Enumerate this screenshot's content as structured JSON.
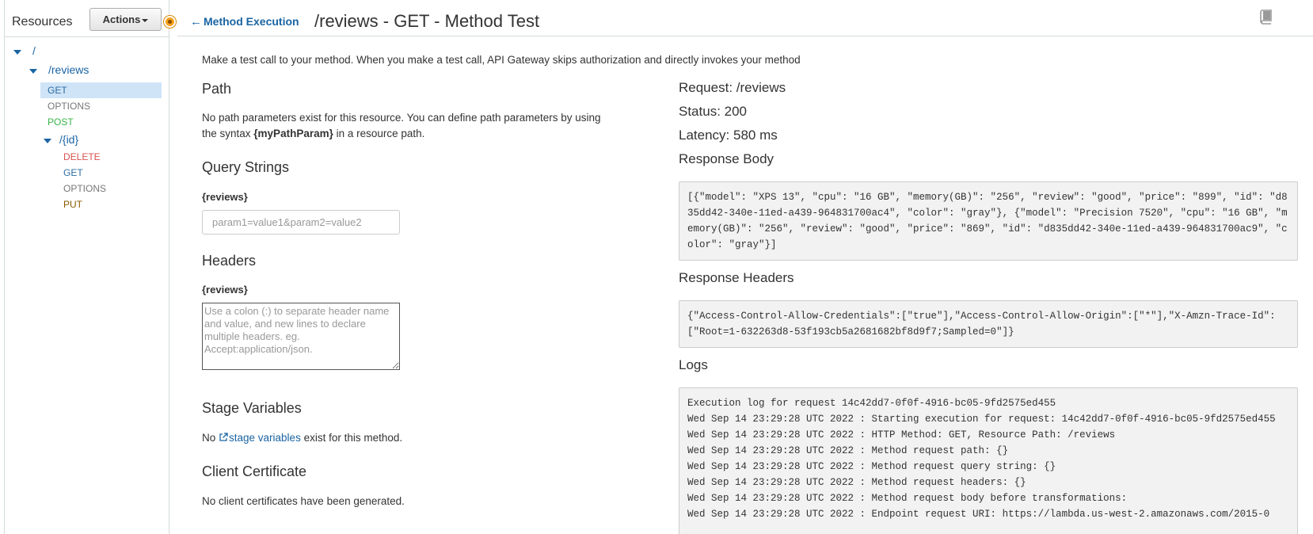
{
  "sidebar": {
    "title": "Resources",
    "actions_label": "Actions",
    "tree": {
      "root": "/",
      "reviews": "/reviews",
      "reviews_methods": [
        "GET",
        "OPTIONS",
        "POST"
      ],
      "id": "/{id}",
      "id_methods": [
        "DELETE",
        "GET",
        "OPTIONS",
        "PUT"
      ]
    },
    "method_colors": {
      "GET": "#2e6da4",
      "OPTIONS": "#777777",
      "POST": "#39b54a",
      "DELETE": "#d9534f",
      "PUT": "#8a5a00"
    }
  },
  "header": {
    "back_label": "Method Execution",
    "title": "/reviews - GET - Method Test",
    "doc_icon": "book-icon"
  },
  "form": {
    "intro": "Make a test call to your method. When you make a test call, API Gateway skips authorization and directly invokes your method",
    "path_heading": "Path",
    "path_text_1": "No path parameters exist for this resource. You can define path parameters by using",
    "path_text_2a": "the syntax ",
    "path_text_2b": "{myPathParam}",
    "path_text_2c": " in a resource path.",
    "query_heading": "Query Strings",
    "query_label": "{reviews}",
    "query_placeholder": "param1=value1&param2=value2",
    "headers_heading": "Headers",
    "headers_label": "{reviews}",
    "headers_placeholder": "Use a colon (:) to separate header name and value, and new lines to declare multiple headers. eg. Accept:application/json.",
    "stage_heading": "Stage Variables",
    "stage_text_a": "No ",
    "stage_link": "stage variables",
    "stage_text_b": " exist for this method.",
    "cert_heading": "Client Certificate",
    "cert_text": "No client certificates have been generated."
  },
  "result": {
    "request": "Request: /reviews",
    "status": "Status: 200",
    "latency": "Latency: 580 ms",
    "body_heading": "Response Body",
    "body": "[{\"model\": \"XPS 13\", \"cpu\": \"16 GB\", \"memory(GB)\": \"256\", \"review\": \"good\", \"price\": \"899\", \"id\": \"d835dd42-340e-11ed-a439-964831700ac4\", \"color\": \"gray\"}, {\"model\": \"Precision 7520\", \"cpu\": \"16 GB\", \"memory(GB)\": \"256\", \"review\": \"good\", \"price\": \"869\", \"id\": \"d835dd42-340e-11ed-a439-964831700ac9\", \"color\": \"gray\"}]",
    "headers_heading": "Response Headers",
    "headers": "{\"Access-Control-Allow-Credentials\":[\"true\"],\"Access-Control-Allow-Origin\":[\"*\"],\"X-Amzn-Trace-Id\":[\"Root=1-632263d8-53f193cb5a2681682bf8d9f7;Sampled=0\"]}",
    "logs_heading": "Logs",
    "logs": [
      "Execution log for request 14c42dd7-0f0f-4916-bc05-9fd2575ed455",
      "Wed Sep 14 23:29:28 UTC 2022 : Starting execution for request: 14c42dd7-0f0f-4916-bc05-9fd2575ed455",
      "Wed Sep 14 23:29:28 UTC 2022 : HTTP Method: GET, Resource Path: /reviews",
      "Wed Sep 14 23:29:28 UTC 2022 : Method request path: {}",
      "Wed Sep 14 23:29:28 UTC 2022 : Method request query string: {}",
      "Wed Sep 14 23:29:28 UTC 2022 : Method request headers: {}",
      "Wed Sep 14 23:29:28 UTC 2022 : Method request body before transformations:",
      "Wed Sep 14 23:29:28 UTC 2022 : Endpoint request URI: https://lambda.us-west-2.amazonaws.com/2015-0"
    ]
  }
}
